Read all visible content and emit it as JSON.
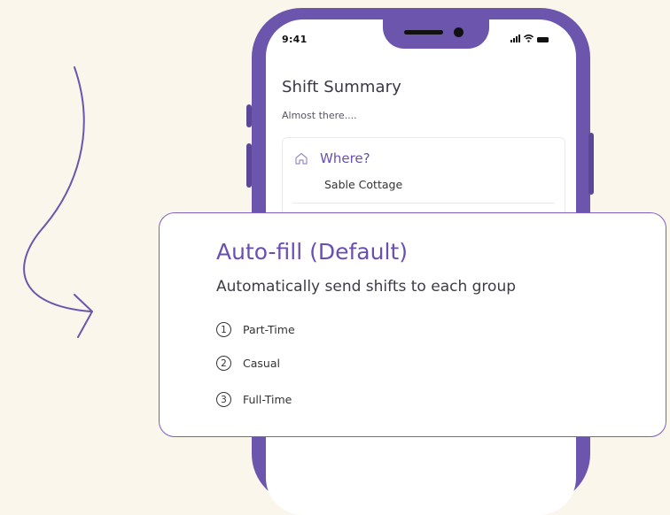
{
  "phone": {
    "status_time": "9:41",
    "screen_title": "Shift Summary",
    "screen_subtitle": "Almost there....",
    "where": {
      "label": "Where?",
      "value": "Sable Cottage"
    }
  },
  "overlay": {
    "title": "Auto-fill (Default)",
    "subtitle": "Automatically send shifts to each group",
    "groups": [
      {
        "number": "1",
        "label": "Part-Time"
      },
      {
        "number": "2",
        "label": "Casual"
      },
      {
        "number": "3",
        "label": "Full-Time"
      }
    ]
  },
  "colors": {
    "background": "#faf6ec",
    "accent": "#6b55ad",
    "accent_text": "#6a4fb3"
  },
  "icons": [
    "curved-arrow-icon",
    "home-icon",
    "signal-icon",
    "wifi-icon",
    "battery-icon"
  ]
}
